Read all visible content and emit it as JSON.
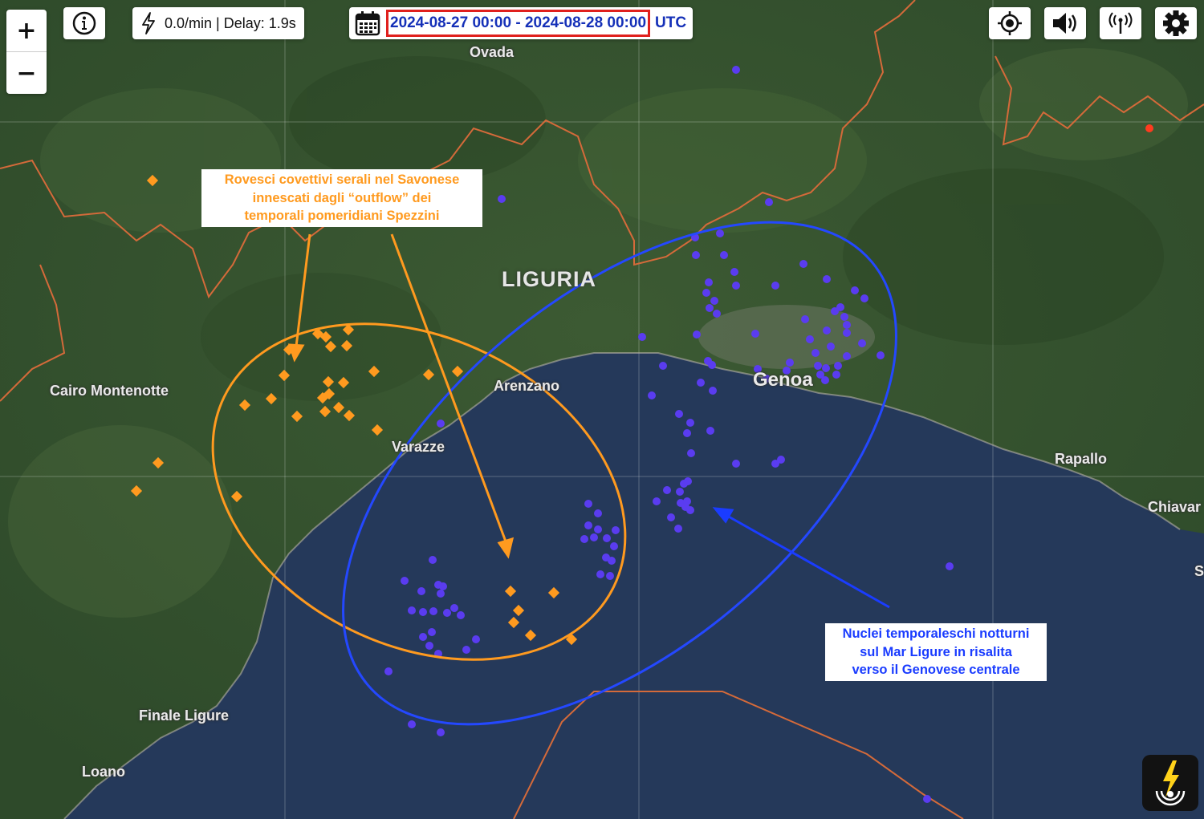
{
  "toolbar": {
    "zoom_in": "+",
    "zoom_out": "−",
    "rate_text": "0.0/min | Delay: 1.9s",
    "date_range": "2024-08-27 00:00 - 2024-08-28 00:00",
    "timezone": "UTC"
  },
  "map": {
    "region_label": "LIGURIA",
    "cities": [
      "Ovada",
      "Cairo Montenotte",
      "Arenzano",
      "Varazze",
      "Genoa",
      "Rapallo",
      "Chiavar",
      "Finale Ligure",
      "Loano",
      "S"
    ]
  },
  "annotations": {
    "orange_label_lines": [
      "Rovesci covettivi serali nel Savonese",
      "innescati dagli “outflow” dei",
      "temporali pomeridiani Spezzini"
    ],
    "blue_label_lines": [
      "Nuclei temporaleschi notturni",
      "sul Mar Ligure in risalita",
      "verso il Genovese centrale"
    ]
  },
  "colors": {
    "orange": "#ff9a1f",
    "blue": "#1a3cff",
    "blue_stroke": "#2448ff",
    "strike_blue": "#5a3cf0",
    "strike_orange": "#ff9a1f",
    "strike_red": "#ff3b1f",
    "border_line": "#d46a3a",
    "date_highlight": "#e0201d"
  },
  "icons": [
    "info-icon",
    "lightning-icon",
    "calendar-icon",
    "locate-icon",
    "sound-icon",
    "antenna-icon",
    "settings-icon",
    "logo-lightning-icon"
  ]
}
